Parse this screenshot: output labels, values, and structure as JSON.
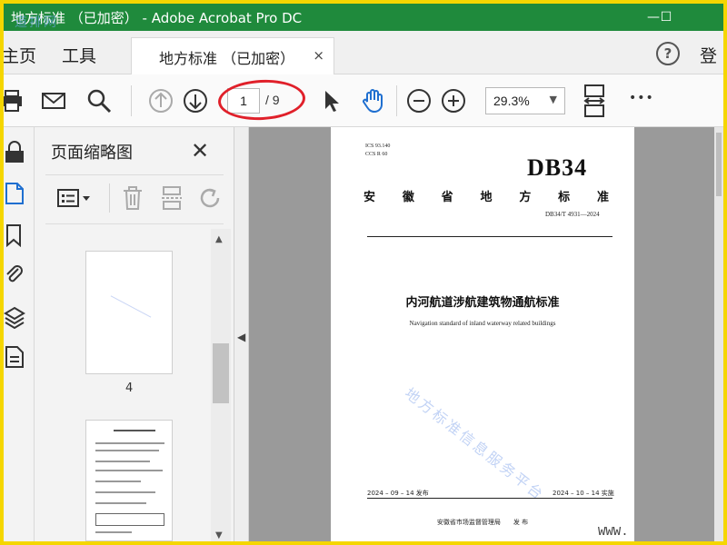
{
  "window": {
    "title": "地方标准 （已加密） - Adobe Acrobat Pro DC",
    "overlay_watermark": "道排网",
    "controls": {
      "minimize": "—",
      "maximize": "☐"
    }
  },
  "menubar": {
    "home": "主页",
    "tools": "工具",
    "tab_label": "地方标准 （已加密）",
    "tab_close": "×",
    "help": "?",
    "login": "登"
  },
  "toolbar": {
    "page_current": "1",
    "page_total": "/ 9",
    "zoom": "29.3%",
    "zoom_arrow": "▼",
    "more": "•••"
  },
  "thumbnails_panel": {
    "title": "页面缩略图",
    "close": "✕",
    "pages": [
      {
        "number": "4"
      },
      {
        "number": ""
      }
    ],
    "scroll_up": "▲",
    "scroll_down": "▼"
  },
  "collapse_handle": "◀",
  "document": {
    "ics": "ICS  93.140",
    "ccs": "CCS  R  60",
    "db_number": "DB34",
    "organization_chars": [
      "安",
      "徽",
      "省",
      "地",
      "方",
      "标",
      "准"
    ],
    "standard_code": "DB34/T 4931—2024",
    "title_zh": "内河航道涉航建筑物通航标准",
    "title_en": "Navigation standard of inland waterway related buildings",
    "watermark": "地方标准信息服务平台",
    "publish_date": "2024 – 09 – 14 发布",
    "implement_date": "2024 – 10 – 14 实施",
    "publisher": "安徽省市场监督管理局　　发 布",
    "www": "WWW."
  },
  "colors": {
    "titlebar": "#1f8a3c",
    "frame": "#f5d600",
    "annotation": "#e0202a",
    "canvas": "#9a9a9a"
  }
}
